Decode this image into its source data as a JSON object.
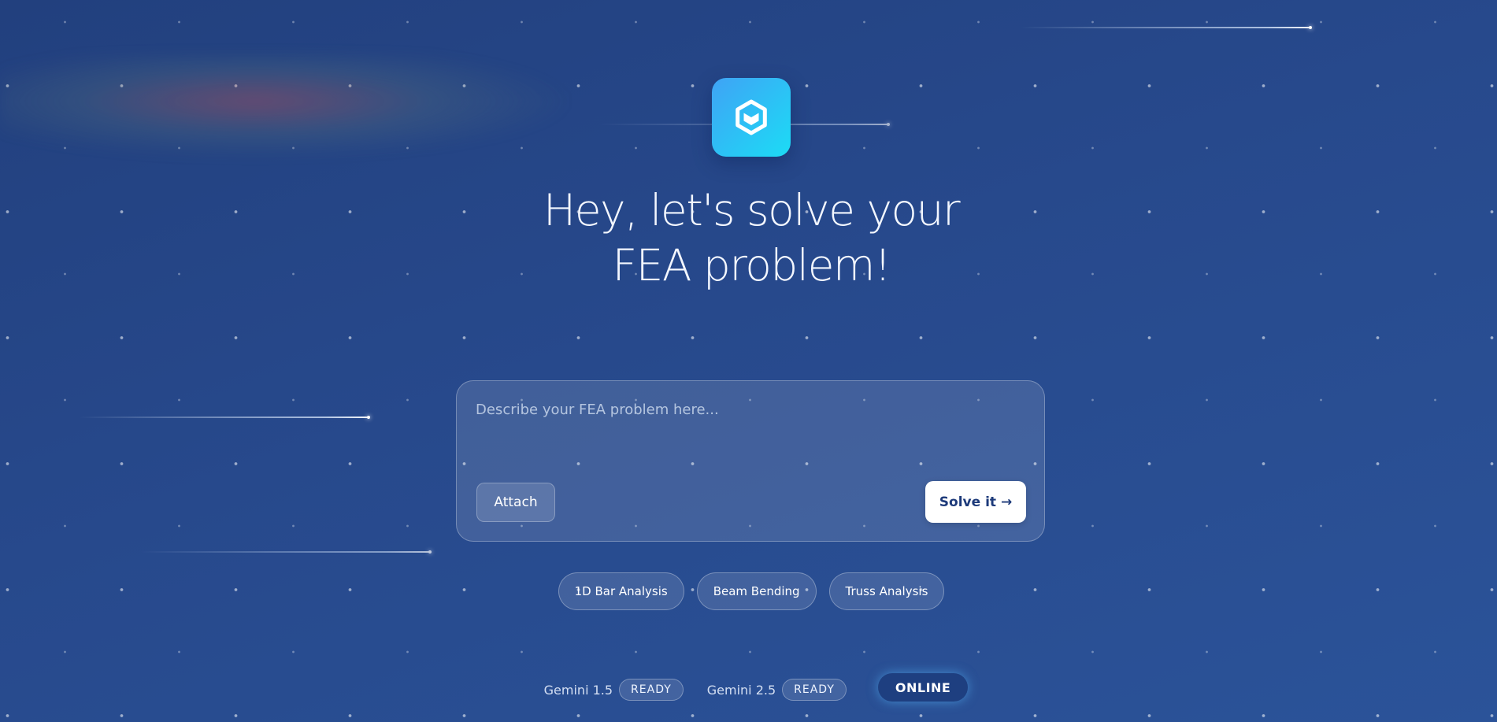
{
  "colors": {
    "background": "#27498c",
    "logo_gradient_start": "#3fa3f5",
    "logo_gradient_end": "#1cdcf5",
    "solve_button_bg": "#ffffff",
    "solve_button_text": "#1d3a7a",
    "online_badge_bg": "#1e3f80"
  },
  "logo": {
    "icon": "hexagon-cube-icon"
  },
  "hero": {
    "title_line1": "Hey, let's solve your",
    "title_line2": "FEA problem!"
  },
  "composer": {
    "placeholder": "Describe your FEA problem here...",
    "value": "",
    "attach_label": "Attach",
    "submit_label": "Solve it →"
  },
  "suggestions": [
    {
      "label": "1D Bar Analysis"
    },
    {
      "label": "Beam Bending"
    },
    {
      "label": "Truss Analysis"
    }
  ],
  "status": {
    "models": [
      {
        "name": "Gemini 1.5",
        "state": "READY"
      },
      {
        "name": "Gemini 2.5",
        "state": "READY"
      }
    ],
    "connection": "ONLINE"
  }
}
